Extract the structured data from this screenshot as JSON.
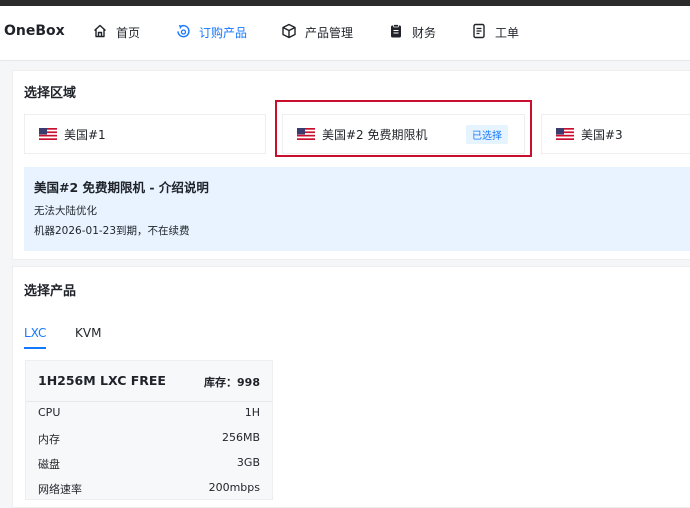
{
  "header": {
    "logo": "OneBox",
    "nav": [
      {
        "label": "首页",
        "icon": "home-icon"
      },
      {
        "label": "订购产品",
        "icon": "order-icon",
        "active": true
      },
      {
        "label": "产品管理",
        "icon": "box-icon"
      },
      {
        "label": "财务",
        "icon": "clipboard-icon"
      },
      {
        "label": "工单",
        "icon": "document-icon"
      }
    ]
  },
  "region_section": {
    "title": "选择区域",
    "regions": [
      {
        "label": "美国#1",
        "selected": false
      },
      {
        "label": "美国#2 免费期限机",
        "selected": true,
        "badge": "已选择"
      },
      {
        "label": "美国#3",
        "selected": false
      }
    ],
    "description": {
      "title": "美国#2 免费期限机 - 介绍说明",
      "lines": [
        "无法大陆优化",
        "机器2026-01-23到期，不在续费"
      ]
    }
  },
  "product_section": {
    "title": "选择产品",
    "tabs": [
      {
        "label": "LXC",
        "active": true
      },
      {
        "label": "KVM",
        "active": false
      }
    ],
    "product": {
      "name": "1H256M LXC FREE",
      "stock": "库存：998",
      "specs": [
        {
          "label": "CPU",
          "value": "1H"
        },
        {
          "label": "内存",
          "value": "256MB"
        },
        {
          "label": "磁盘",
          "value": "3GB"
        },
        {
          "label": "网络速率",
          "value": "200mbps"
        }
      ]
    }
  },
  "colors": {
    "accent": "#1677ff",
    "selected_outline": "#c8102e",
    "info_background": "#e8f3ff"
  }
}
